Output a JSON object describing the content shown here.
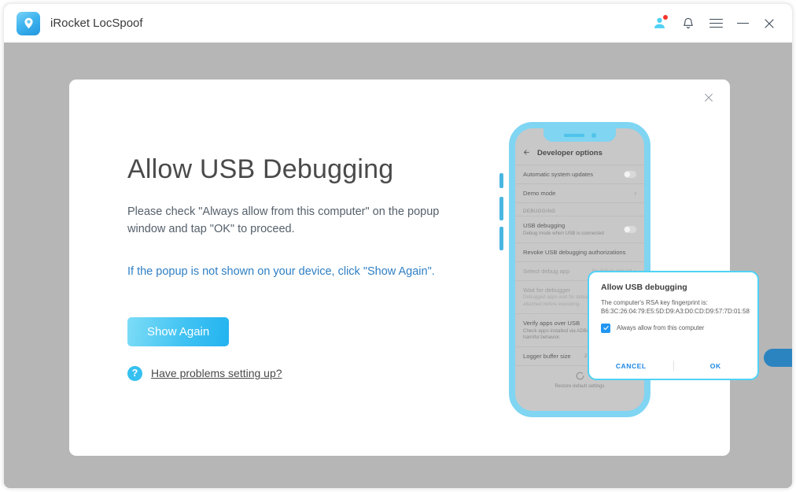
{
  "window": {
    "app_title": "iRocket LocSpoof",
    "logo_icon": "location-pin-icon",
    "titlebar_icons": {
      "account": "user-account-icon",
      "notification": "bell-icon",
      "menu": "hamburger-menu-icon",
      "minimize": "minimize-icon",
      "close": "close-icon"
    },
    "side_tab": "side-panel-handle"
  },
  "modal": {
    "close_icon": "close-icon",
    "heading": "Allow USB Debugging",
    "description": "Please check \"Always allow from this computer\" on the popup window and tap \"OK\" to proceed.",
    "note": "If the popup is not shown on your device, click \"Show Again\".",
    "primary_button": "Show Again",
    "help_icon": "question-mark-icon",
    "help_link": "Have problems setting up?"
  },
  "phone": {
    "back_icon": "back-arrow-icon",
    "screen_title": "Developer options",
    "rows": [
      {
        "label": "Automatic system updates",
        "sub": "",
        "value": "",
        "control": "toggle",
        "dim": false
      },
      {
        "label": "Demo mode",
        "sub": "",
        "value": "",
        "control": "chevron",
        "dim": false
      }
    ],
    "section_debugging": "DEBUGGING",
    "hidden_rows": [
      {
        "label": "USB debugging",
        "sub": "Debug mode when USB is connected",
        "value": "",
        "control": "toggle",
        "dim": false
      },
      {
        "label": "Revoke USB debugging authorizations",
        "sub": "",
        "value": "",
        "control": "none",
        "dim": false
      }
    ],
    "lower_rows": [
      {
        "label": "Select debug app",
        "sub": "",
        "value": "No debug app set",
        "control": "chevron",
        "dim": true
      },
      {
        "label": "Wait for debugger",
        "sub": "Debugged apps wait for debugger to be attached before executing.",
        "value": "",
        "control": "toggle",
        "dim": true
      },
      {
        "label": "Verify apps over USB",
        "sub": "Check apps installed via ADB/ADT for harmful behavior.",
        "value": "",
        "control": "toggle",
        "dim": false
      },
      {
        "label": "Logger buffer size",
        "sub": "",
        "value": "256 KB per log buffer",
        "control": "chevron",
        "dim": false
      }
    ],
    "restore_icon": "refresh-circle-icon",
    "restore_label": "Restore default settings"
  },
  "android_dialog": {
    "title": "Allow USB debugging",
    "body": "The computer's RSA key fingerprint is: B6:3C:26:04:79:E5:5D:D9:A3:D0:CD:D9:57:7D:01:58",
    "checkbox_label": "Always allow from this computer",
    "checkbox_checked": true,
    "cancel_label": "CANCEL",
    "ok_label": "OK"
  },
  "colors": {
    "accent": "#35c0f0",
    "overlay": "#b6b6b6",
    "link": "#2f7fc4",
    "dialog_border": "#4fd2f7",
    "badge": "#f4352c",
    "side_tab": "#2b84c0"
  }
}
